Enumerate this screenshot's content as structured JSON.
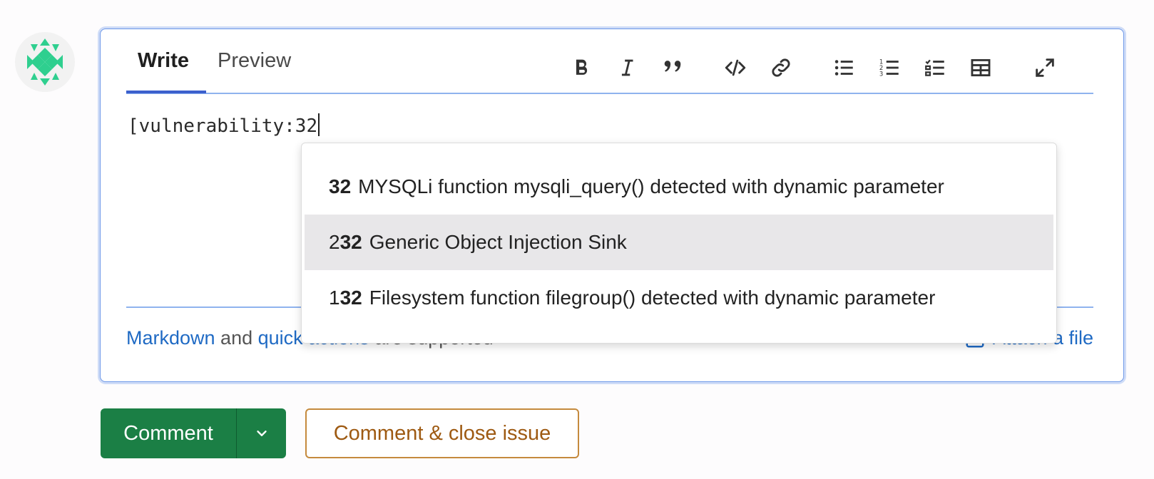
{
  "tabs": {
    "write": "Write",
    "preview": "Preview"
  },
  "toolbar": {
    "icons": [
      "bold-icon",
      "italic-icon",
      "quote-icon",
      "code-icon",
      "link-icon",
      "bullet-list-icon",
      "numbered-list-icon",
      "task-list-icon",
      "table-icon",
      "fullscreen-icon"
    ]
  },
  "editor": {
    "text": "[vulnerability:32"
  },
  "autocomplete": [
    {
      "prefix": "",
      "match": "32",
      "title": "MYSQLi function mysqli_query() detected with dynamic parameter",
      "selected": false
    },
    {
      "prefix": "2",
      "match": "32",
      "title": "Generic Object Injection Sink",
      "selected": true
    },
    {
      "prefix": "1",
      "match": "32",
      "title": "Filesystem function filegroup() detected with dynamic parameter",
      "selected": false
    }
  ],
  "footer": {
    "markdown": "Markdown",
    "and": " and ",
    "quick_actions": "quick actions",
    "supported": " are supported",
    "attach": "Attach a file"
  },
  "buttons": {
    "comment": "Comment",
    "close": "Comment & close issue"
  },
  "colors": {
    "primary_green": "#1b7f45",
    "link_blue": "#1f6ac4",
    "focus_border": "#6e98e8",
    "warning_outline": "#c58a3d"
  }
}
